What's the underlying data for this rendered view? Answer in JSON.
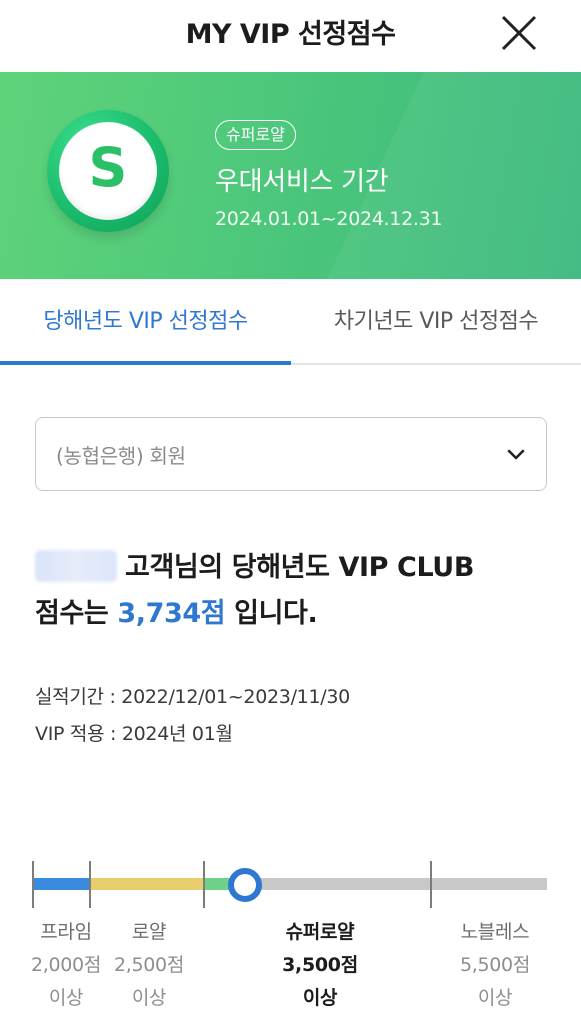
{
  "header": {
    "title": "MY VIP 선정점수"
  },
  "banner": {
    "badge_letter": "S",
    "tier": "슈퍼로얄",
    "service_label": "우대서비스 기간",
    "period": "2024.01.01~2024.12.31"
  },
  "tabs": [
    {
      "label": "당해년도 VIP 선정점수",
      "active": true
    },
    {
      "label": "차기년도 VIP 선정점수",
      "active": false
    }
  ],
  "member_select": {
    "value": "(농협은행) 회원"
  },
  "summary": {
    "line1_suffix": "고객님의 당해년도 VIP CLUB",
    "line2_prefix": "점수는 ",
    "score": "3,734점",
    "line2_suffix": " 입니다."
  },
  "info": {
    "period_label": "실적기간 : 2022/12/01~2023/11/30",
    "apply_label": "VIP 적용 : 2024년 01월"
  },
  "progress": {
    "current_score": 3734,
    "colors": {
      "prime": "#3a8be0",
      "royal": "#e8cf6e",
      "super_royal": "#6fd08a",
      "track": "#c8c8c8",
      "accent": "#2f78d0"
    },
    "tiers": [
      {
        "name": "프라임",
        "threshold": "2,000점",
        "suffix": "이상",
        "active": false
      },
      {
        "name": "로얄",
        "threshold": "2,500점",
        "suffix": "이상",
        "active": false
      },
      {
        "name": "슈퍼로얄",
        "threshold": "3,500점",
        "suffix": "이상",
        "active": true
      },
      {
        "name": "노블레스",
        "threshold": "5,500점",
        "suffix": "이상",
        "active": false
      }
    ]
  }
}
